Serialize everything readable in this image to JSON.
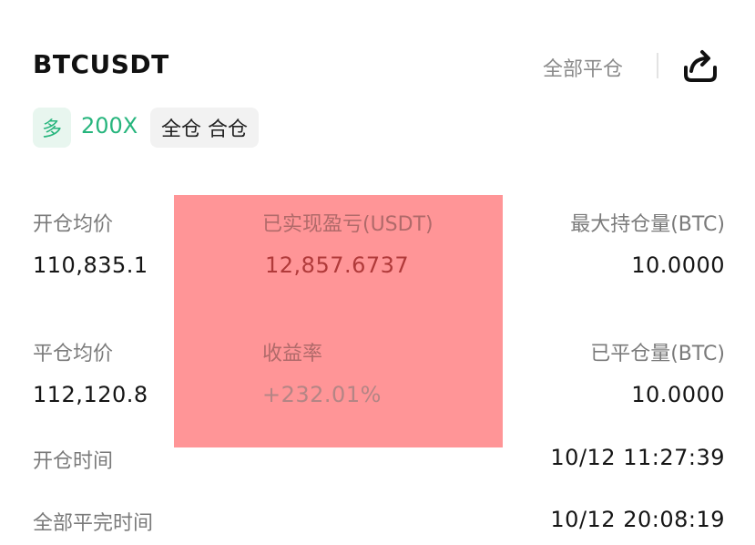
{
  "header": {
    "symbol": "BTCUSDT",
    "close_all_label": "全部平仓",
    "share_icon": "share-icon"
  },
  "tags": {
    "side": "多",
    "leverage": "200X",
    "margin_mode": "全仓 合仓"
  },
  "stats": {
    "open_avg_price_label": "开仓均价",
    "open_avg_price": "110,835.1",
    "realized_pnl_label": "已实现盈亏(USDT)",
    "realized_pnl": "12,857.6737",
    "max_position_label": "最大持仓量(BTC)",
    "max_position": "10.0000",
    "close_avg_price_label": "平仓均价",
    "close_avg_price": "112,120.8",
    "roi_label": "收益率",
    "roi": "+232.01%",
    "closed_position_label": "已平仓量(BTC)",
    "closed_position": "10.0000",
    "open_time_label": "开仓时间",
    "open_time": "10/12 11:27:39",
    "close_time_label": "全部平完时间",
    "close_time": "10/12 20:08:19"
  },
  "colors": {
    "long_green": "#27b57d",
    "redaction": "#ff9597"
  }
}
